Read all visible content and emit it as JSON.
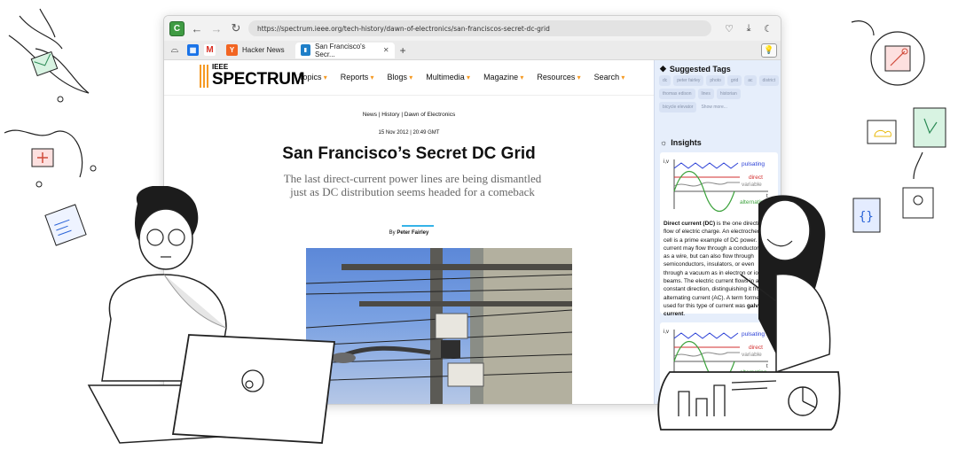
{
  "browser": {
    "profile_initial": "C",
    "url": "https://spectrum.ieee.org/tech-history/dawn-of-electronics/san-franciscos-secret-dc-grid",
    "tabs": [
      {
        "label": "Hacker News",
        "favicon": "Y",
        "favicon_color": "#f26522"
      },
      {
        "label": "San Francisco's Secr...",
        "favicon": "IEEE",
        "active": true
      }
    ]
  },
  "site": {
    "logo_top": "IEEE",
    "logo_main": "SPECTRUM",
    "nav": [
      "Topics",
      "Reports",
      "Blogs",
      "Multimedia",
      "Magazine",
      "Resources",
      "Search"
    ]
  },
  "article": {
    "breadcrumb": "News | History | Dawn of Electronics",
    "date": "15 Nov 2012 | 20:49 GMT",
    "title": "San Francisco’s Secret DC Grid",
    "subtitle": "The last direct-current power lines are being dismantled just as DC distribution seems headed for a comeback",
    "byline_prefix": "By",
    "author": "Peter Fairley"
  },
  "sidebar": {
    "tags_heading": "Suggested Tags",
    "tags": [
      "dc",
      "peter fairley",
      "photo",
      "grid",
      "ac",
      "district",
      "thomas edison",
      "lines",
      "historian",
      "bicycle elevator"
    ],
    "show_more": "Show more...",
    "insights_heading": "Insights",
    "chart_labels": {
      "axis_y": "i,v",
      "axis_x": "t",
      "pulsating": "pulsating",
      "direct": "direct",
      "variable": "variable",
      "alternating": "alternating"
    },
    "insight_text_bold": "Direct current (DC)",
    "insight_text_1": " is the one directional flow of electric charge. An electrochemical cell is a prime example of DC power. Direct current may flow through a conductor such as a wire, but can also flow through semiconductors, insulators, or even through a vacuum as in electron or ion beams. The electric current flows in a constant direction, distinguishing it from alternating current (AC). A term formerly used for this type of current was ",
    "insight_text_bold2": "galvanic current",
    "insight_text_end": "."
  },
  "colors": {
    "pulsating": "#2a3fd6",
    "direct": "#d32f2f",
    "variable": "#888888",
    "alternating": "#3ea33e",
    "sidebar_bg": "#e6eefb",
    "accent": "#f59a23"
  }
}
